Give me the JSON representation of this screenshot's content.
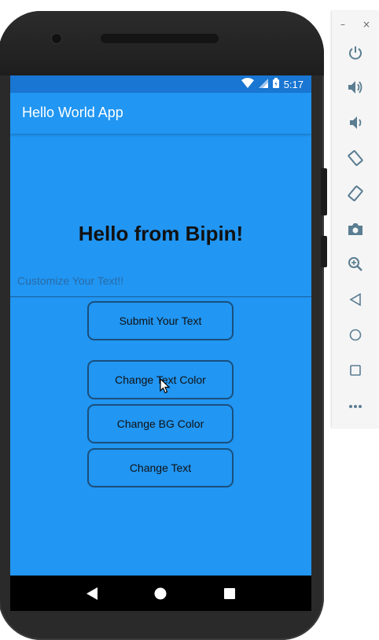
{
  "status_bar": {
    "time": "5:17"
  },
  "app_bar": {
    "title": "Hello World App"
  },
  "main": {
    "headline": "Hello from Bipin!",
    "text_input": {
      "placeholder": "Customize Your Text!!",
      "value": ""
    },
    "buttons": {
      "submit": "Submit Your Text",
      "change_text_color": "Change Text Color",
      "change_bg_color": "Change BG Color",
      "change_text": "Change Text"
    }
  },
  "emulator_toolbar": {
    "minimize": "–",
    "close": "×",
    "icons": [
      "power-icon",
      "volume-up-icon",
      "volume-down-icon",
      "rotate-left-icon",
      "rotate-right-icon",
      "camera-icon",
      "zoom-icon",
      "back-icon",
      "home-icon",
      "overview-icon",
      "more-icon"
    ]
  },
  "colors": {
    "primary": "#2196f3",
    "status_bar": "#1976d2",
    "button_border": "#1a4f7c"
  }
}
